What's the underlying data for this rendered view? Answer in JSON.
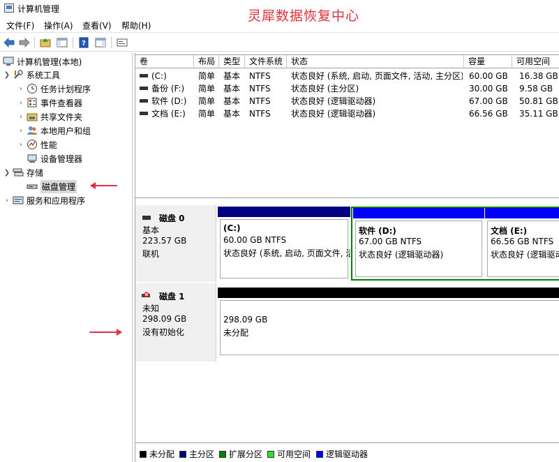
{
  "window": {
    "title": "计算机管理",
    "watermark": "灵犀数据恢复中心"
  },
  "menu": [
    "文件(F)",
    "操作(A)",
    "查看(V)",
    "帮助(H)"
  ],
  "toolbar": {
    "icons": [
      "back-arrow-icon",
      "forward-arrow-icon",
      "up-folder-icon",
      "show-tree-icon",
      "help-icon",
      "action-pane-icon",
      "console-icon"
    ]
  },
  "tree": {
    "root": "计算机管理(本地)",
    "system_tools": "系统工具",
    "task_scheduler": "任务计划程序",
    "event_viewer": "事件查看器",
    "shared_folders": "共享文件夹",
    "local_users": "本地用户和组",
    "performance": "性能",
    "device_manager": "设备管理器",
    "storage": "存储",
    "disk_management": "磁盘管理",
    "services_apps": "服务和应用程序"
  },
  "volume_table": {
    "headers": [
      "卷",
      "布局",
      "类型",
      "文件系统",
      "状态",
      "容量",
      "可用空间"
    ],
    "rows": [
      [
        "(C:)",
        "简单",
        "基本",
        "NTFS",
        "状态良好 (系统, 启动, 页面文件, 活动, 主分区)",
        "60.00 GB",
        "16.38 GB"
      ],
      [
        "备份 (F:)",
        "简单",
        "基本",
        "NTFS",
        "状态良好 (主分区)",
        "30.00 GB",
        "9.58 GB"
      ],
      [
        "软件 (D:)",
        "简单",
        "基本",
        "NTFS",
        "状态良好 (逻辑驱动器)",
        "67.00 GB",
        "50.81 GB"
      ],
      [
        "文档 (E:)",
        "简单",
        "基本",
        "NTFS",
        "状态良好 (逻辑驱动器)",
        "66.56 GB",
        "35.11 GB"
      ]
    ]
  },
  "disks": {
    "disk0": {
      "name": "磁盘 0",
      "type": "基本",
      "size": "223.57 GB",
      "status": "联机",
      "partitions": {
        "c": {
          "title": "(C:)",
          "size": "60.00 GB NTFS",
          "status": "状态良好 (系统, 启动, 页面文件, 活动, 主分区)"
        },
        "d": {
          "title": "软件  (D:)",
          "size": "67.00 GB NTFS",
          "status": "状态良好 (逻辑驱动器)"
        },
        "e": {
          "title": "文档  (E:)",
          "size": "66.56 GB NTFS",
          "status": "状态良好 (逻辑驱动器)"
        }
      }
    },
    "disk1": {
      "name": "磁盘 1",
      "type": "未知",
      "size": "298.09 GB",
      "status": "没有初始化",
      "unallocated": {
        "size": "298.09 GB",
        "label": "未分配"
      }
    }
  },
  "legend": [
    {
      "label": "未分配",
      "color": "#000000"
    },
    {
      "label": "主分区",
      "color": "#000080"
    },
    {
      "label": "扩展分区",
      "color": "#008000"
    },
    {
      "label": "可用空间",
      "color": "#33dd33"
    },
    {
      "label": "逻辑驱动器",
      "color": "#0000ff"
    }
  ],
  "colors": {
    "primary": "#000080",
    "logical": "#0000ff",
    "extended": "#008000",
    "unallocated": "#000000",
    "annotation": "#e0303a"
  }
}
